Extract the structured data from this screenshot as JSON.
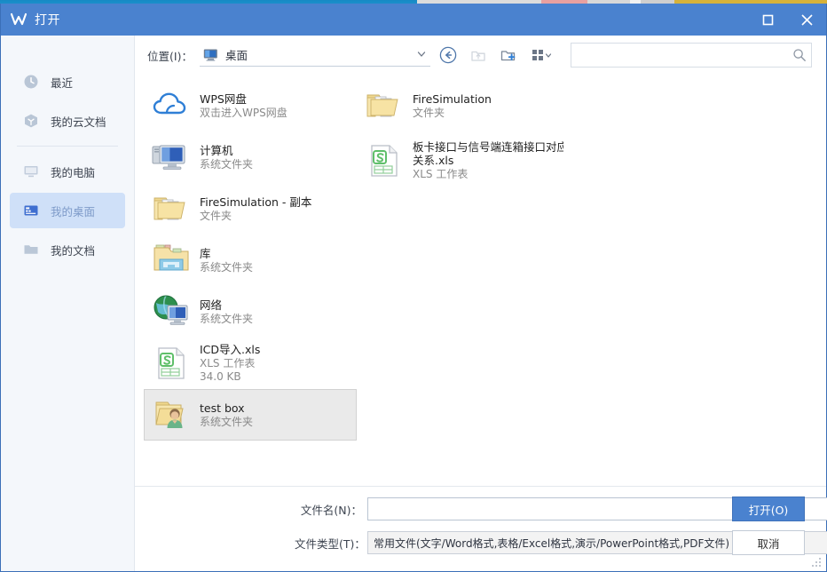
{
  "window": {
    "title": "打开",
    "logo_icon": "wps-w-logo-icon",
    "maximize_label": "□",
    "close_label": "✕"
  },
  "sidebar": {
    "items": [
      {
        "label": "最近",
        "icon": "clock-icon",
        "selected": false
      },
      {
        "label": "我的云文档",
        "icon": "cloud-doc-icon",
        "selected": false
      },
      {
        "label": "我的电脑",
        "icon": "monitor-icon",
        "selected": false
      },
      {
        "label": "我的桌面",
        "icon": "desktop-icon",
        "selected": true
      },
      {
        "label": "我的文档",
        "icon": "folder-icon",
        "selected": false
      }
    ],
    "divider_after_index": 1
  },
  "toolbar": {
    "location_label": "位置(I)：",
    "location_value": "桌面",
    "location_icon": "monitor-icon",
    "chevron_icon": "chevron-down-icon",
    "back_button": "back-circle-icon",
    "up_button": "up-folder-icon",
    "new_folder_button": "new-folder-icon",
    "view_mode_button": "view-grid-icon"
  },
  "search": {
    "value": "",
    "placeholder": "",
    "icon": "search-icon"
  },
  "files": [
    {
      "name": "WPS网盘",
      "sub": "双击进入WPS网盘",
      "size": "",
      "icon": "cloud-drive-icon",
      "selected": false
    },
    {
      "name": "计算机",
      "sub": "系统文件夹",
      "size": "",
      "icon": "computer-icon",
      "selected": false
    },
    {
      "name": "FireSimulation - 副本",
      "sub": "文件夹",
      "size": "",
      "icon": "folder-docs-icon",
      "selected": false
    },
    {
      "name": "库",
      "sub": "系统文件夹",
      "size": "",
      "icon": "library-icon",
      "selected": false
    },
    {
      "name": "网络",
      "sub": "系统文件夹",
      "size": "",
      "icon": "network-icon",
      "selected": false
    },
    {
      "name": "ICD导入.xls",
      "sub": "XLS 工作表",
      "size": "34.0 KB",
      "icon": "xls-file-icon",
      "selected": false
    },
    {
      "name": "test box",
      "sub": "系统文件夹",
      "size": "",
      "icon": "user-folder-icon",
      "selected": true
    },
    {
      "name": "FireSimulation",
      "sub": "文件夹",
      "size": "",
      "icon": "folder-docs-icon",
      "selected": false
    },
    {
      "name": "板卡接口与信号端连箱接口对应关系.xls",
      "sub": "XLS 工作表",
      "size": "",
      "icon": "xls-file-icon",
      "selected": false
    }
  ],
  "footer": {
    "filename_label": "文件名(N)：",
    "filename_value": "",
    "filetype_label": "文件类型(T)：",
    "filetype_value": "常用文件(文字/Word格式,表格/Excel格式,演示/PowerPoint格式,PDF文件)",
    "open_label": "打开(O)",
    "cancel_label": "取消"
  },
  "colors": {
    "titlebar": "#4a82cf",
    "accent": "#4a82cf",
    "sidebar_bg": "#f4f7fb",
    "sidebar_selected": "#cfe0f8",
    "file_selected": "#eaeaea"
  }
}
